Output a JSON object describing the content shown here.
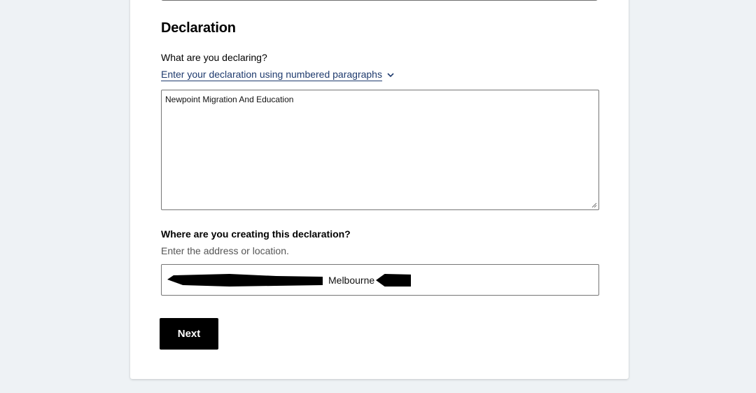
{
  "section": {
    "heading": "Declaration"
  },
  "declaration": {
    "question": "What are you declaring?",
    "disclosure_label": "Enter your declaration using numbered paragraphs",
    "text_value": "Newpoint Migration And Education"
  },
  "location": {
    "question": "Where are you creating this declaration?",
    "hint": "Enter the address or location.",
    "visible_value": "Melbourne"
  },
  "actions": {
    "next_label": "Next"
  },
  "colors": {
    "page_background": "#eef2f5",
    "link": "#1f3b6e",
    "button": "#000000"
  },
  "icons": [
    "chevron-down-icon",
    "resize-handle-icon"
  ]
}
